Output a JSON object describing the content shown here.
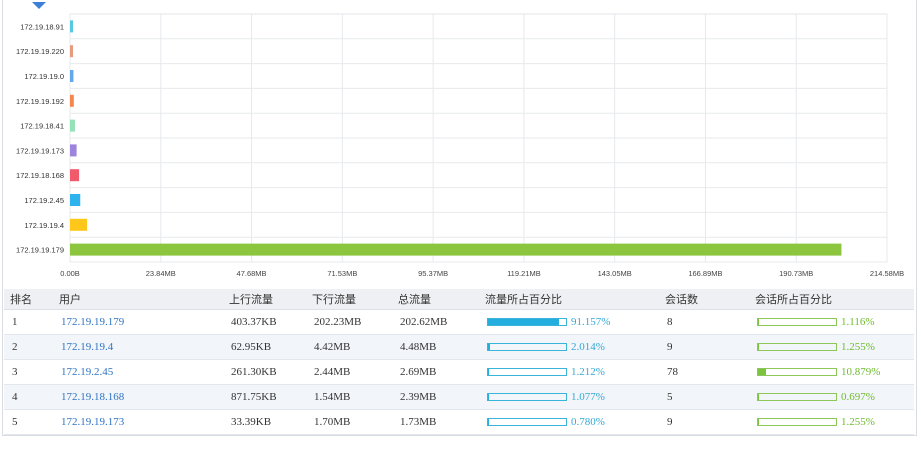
{
  "chart_data": {
    "type": "bar",
    "orientation": "horizontal",
    "categories": [
      "172.19.18.91",
      "172.19.19.220",
      "172.19.19.0",
      "172.19.19.192",
      "172.19.18.41",
      "172.19.19.173",
      "172.19.18.168",
      "172.19.2.45",
      "172.19.19.4",
      "172.19.19.179"
    ],
    "values_mb": [
      0.5,
      0.7,
      0.9,
      1.0,
      1.3,
      1.73,
      2.39,
      2.69,
      4.48,
      202.62
    ],
    "colors": [
      "#56c8df",
      "#e89a7e",
      "#62a8e8",
      "#f4874b",
      "#94e2b8",
      "#9b83de",
      "#f05a6b",
      "#2eb3ee",
      "#ffc71a",
      "#8cc63f"
    ],
    "xticks": [
      "0.00B",
      "23.84MB",
      "47.68MB",
      "71.53MB",
      "95.37MB",
      "119.21MB",
      "143.05MB",
      "166.89MB",
      "190.73MB",
      "214.58MB"
    ],
    "xlim": [
      0,
      214.58
    ],
    "grid": true
  },
  "table": {
    "headers": [
      "排名",
      "用户",
      "上行流量",
      "下行流量",
      "总流量",
      "流量所占百分比",
      "会话数",
      "会话所占百分比"
    ],
    "rows": [
      {
        "rank": "1",
        "user": "172.19.19.179",
        "up": "403.37KB",
        "down": "202.23MB",
        "total": "202.62MB",
        "flow_pct": "91.157%",
        "flow_frac": 0.91157,
        "sessions": "8",
        "sess_pct": "1.116%",
        "sess_frac": 0.01116
      },
      {
        "rank": "2",
        "user": "172.19.19.4",
        "up": "62.95KB",
        "down": "4.42MB",
        "total": "4.48MB",
        "flow_pct": "2.014%",
        "flow_frac": 0.02014,
        "sessions": "9",
        "sess_pct": "1.255%",
        "sess_frac": 0.01255
      },
      {
        "rank": "3",
        "user": "172.19.2.45",
        "up": "261.30KB",
        "down": "2.44MB",
        "total": "2.69MB",
        "flow_pct": "1.212%",
        "flow_frac": 0.01212,
        "sessions": "78",
        "sess_pct": "10.879%",
        "sess_frac": 0.10879
      },
      {
        "rank": "4",
        "user": "172.19.18.168",
        "up": "871.75KB",
        "down": "1.54MB",
        "total": "2.39MB",
        "flow_pct": "1.077%",
        "flow_frac": 0.01077,
        "sessions": "5",
        "sess_pct": "0.697%",
        "sess_frac": 0.00697
      },
      {
        "rank": "5",
        "user": "172.19.19.173",
        "up": "33.39KB",
        "down": "1.70MB",
        "total": "1.73MB",
        "flow_pct": "0.780%",
        "flow_frac": 0.0078,
        "sessions": "9",
        "sess_pct": "1.255%",
        "sess_frac": 0.01255
      }
    ]
  }
}
